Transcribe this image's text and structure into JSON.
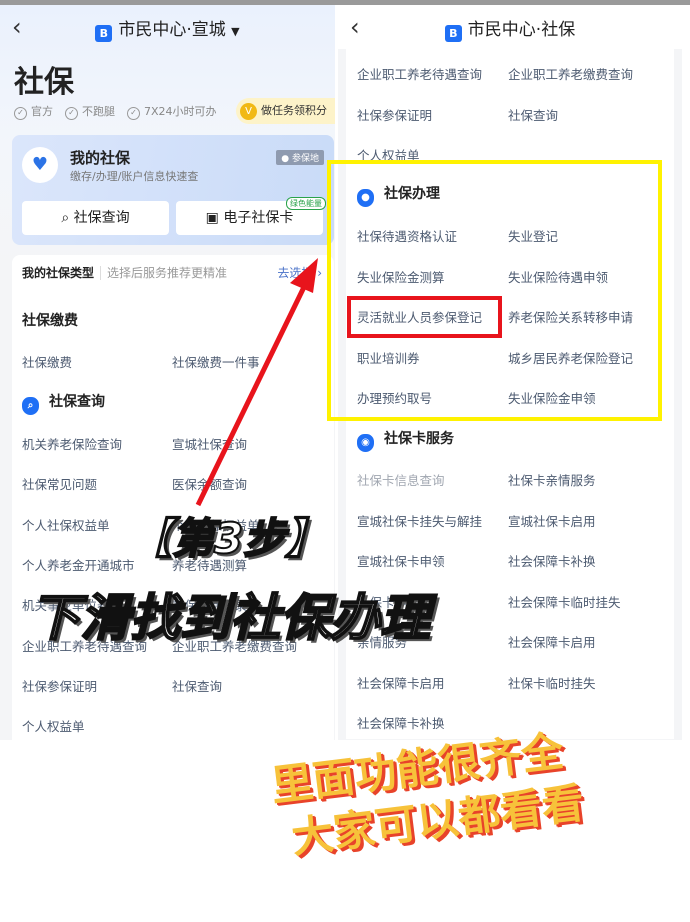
{
  "left": {
    "nav_title": "市民中心·宣城",
    "page_title": "社保",
    "tags": [
      "官方",
      "不跑腿",
      "7X24小时可办"
    ],
    "task_label": "做任务领积分",
    "card": {
      "title": "我的社保",
      "subtitle": "缴存/办理/账户信息快速查",
      "location_badge": "参保地",
      "query_button": "社保查询",
      "ecard_button": "电子社保卡",
      "green_badge": "绿色能量"
    },
    "type_bar": {
      "label": "我的社保类型",
      "hint": "选择后服务推荐更精准",
      "action": "去选择"
    },
    "sections": [
      {
        "title": "社保缴费",
        "icon": "none",
        "items": [
          "社保缴费",
          "社保缴费一件事"
        ]
      },
      {
        "title": "社保查询",
        "icon": "search-shield",
        "items": [
          "机关养老保险查询",
          "宣城社保查询",
          "社保常见问题",
          "医保余额查询",
          "个人社保权益单",
          "个人参保权益单",
          "个人养老金开通城市",
          "养老待遇测算",
          "机关事业单位养老",
          "社保缴费记录",
          "企业职工养老待遇查询",
          "企业职工养老缴费查询",
          "社保参保证明",
          "社保查询",
          "个人权益单"
        ]
      }
    ]
  },
  "right": {
    "nav_title": "市民中心·社保",
    "top_items": [
      "企业职工养老待遇查询",
      "企业职工养老缴费查询",
      "社保参保证明",
      "社保查询",
      "个人权益单"
    ],
    "handle_section": {
      "title": "社保办理",
      "items": [
        "社保待遇资格认证",
        "失业登记",
        "失业保险金测算",
        "失业保险待遇申领",
        "灵活就业人员参保登记",
        "养老保险关系转移申请",
        "职业培训券",
        "城乡居民养老保险登记",
        "办理预约取号",
        "失业保险金申领"
      ]
    },
    "card_section": {
      "title": "社保卡服务",
      "items": [
        "社保卡信息查询",
        "社保卡亲情服务",
        "宣城社保卡挂失与解挂",
        "宣城社保卡启用",
        "宣城社保卡申领",
        "社会保障卡补换",
        "社保卡申领",
        "社会保障卡临时挂失",
        "亲情服务",
        "社会保障卡启用",
        "社会保障卡启用",
        "社保卡临时挂失",
        "社会保障卡补换"
      ]
    }
  },
  "annotations": {
    "step": "【第3步】",
    "instruction": "下滑找到社保办理",
    "promo_line1": "里面功能很齐全",
    "promo_line2": "大家可以都看看"
  },
  "colors": {
    "highlight_box": "#fff200",
    "target_box": "#e8141c",
    "arrow": "#e8141c",
    "accent": "#1f6ff5"
  }
}
